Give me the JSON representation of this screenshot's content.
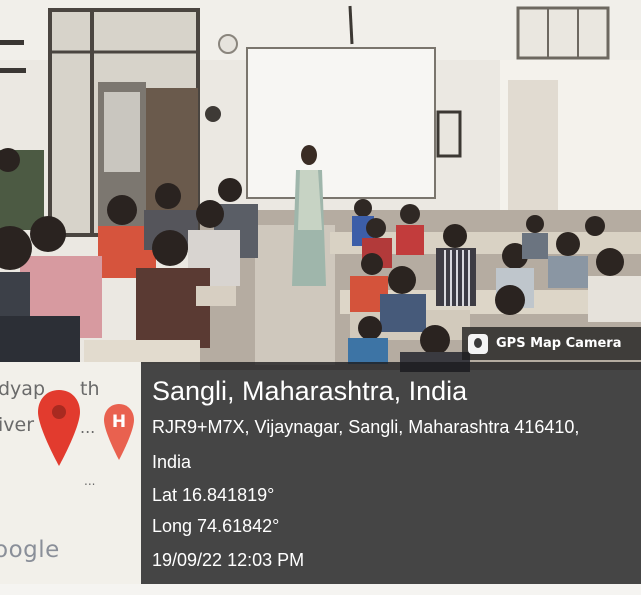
{
  "badge": {
    "label": "GPS Map Camera",
    "icon": "gps-map-camera-icon"
  },
  "map": {
    "fragment_1": "dyap",
    "fragment_1b": "th",
    "fragment_2": "iver",
    "fragment_2b": "...",
    "fragment_3": "...",
    "google": "oogle",
    "pin_color": "#e23b2e",
    "hospital_marker_letter": "H",
    "hospital_color": "#e9614f"
  },
  "location": {
    "title": "Sangli, Maharashtra, India",
    "address_line1": "RJR9+M7X, Vijaynagar, Sangli, Maharashtra 416410,",
    "address_line2": "India",
    "latitude": "Lat 16.841819°",
    "longitude": "Long 74.61842°",
    "datetime": "19/09/22  12:03 PM"
  }
}
